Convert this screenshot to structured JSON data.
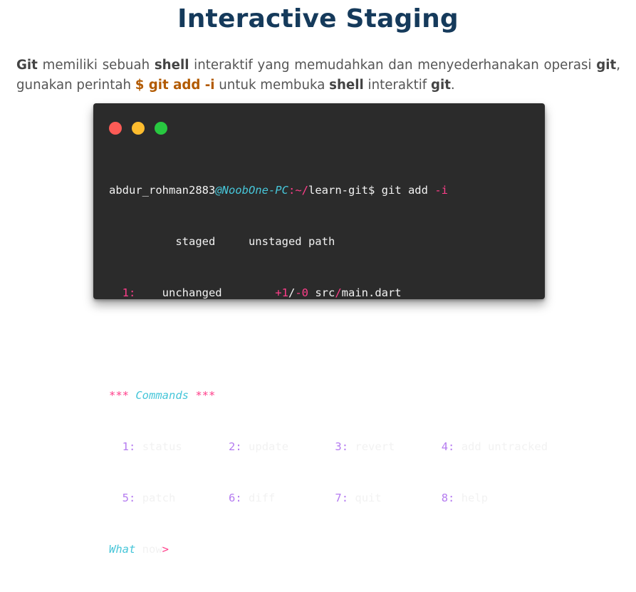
{
  "title": "Interactive Staging",
  "intro": {
    "w1": "Git",
    "t1": " memiliki sebuah ",
    "w2": "shell",
    "t2": " interaktif yang memudahkan dan menyederhanakan operasi ",
    "w3": "git",
    "t3": ", gunakan perintah ",
    "cmd": "$ git add -i",
    "t4": " untuk membuka ",
    "w4": "shell",
    "t5": " interaktif ",
    "w5": "git",
    "t6": "."
  },
  "terminal": {
    "prompt": {
      "user": "abdur_rohman2883",
      "at_host": "@NoobOne-PC",
      "colon": ":",
      "tilde": "~",
      "slash": "/",
      "dir": "learn-git$ git add ",
      "flag": "-i"
    },
    "header": "          staged     unstaged path",
    "row": {
      "num": "  1:",
      "status": "    unchanged        ",
      "add": "+1",
      "slash": "/",
      "del": "-0",
      "path_pre": " src",
      "path_sep": "/",
      "path_post": "main.dart"
    },
    "commands_header": {
      "stars_left": "***",
      "label": " Commands ",
      "stars_right": "***"
    },
    "commands": [
      {
        "num": "1:",
        "label": "status"
      },
      {
        "num": "2:",
        "label": "update"
      },
      {
        "num": "3:",
        "label": "revert"
      },
      {
        "num": "4:",
        "label": "add untracked"
      },
      {
        "num": "5:",
        "label": "patch"
      },
      {
        "num": "6:",
        "label": "diff"
      },
      {
        "num": "7:",
        "label": "quit"
      },
      {
        "num": "8:",
        "label": "help"
      }
    ],
    "what": "What",
    "now": " now",
    "gt": ">"
  }
}
